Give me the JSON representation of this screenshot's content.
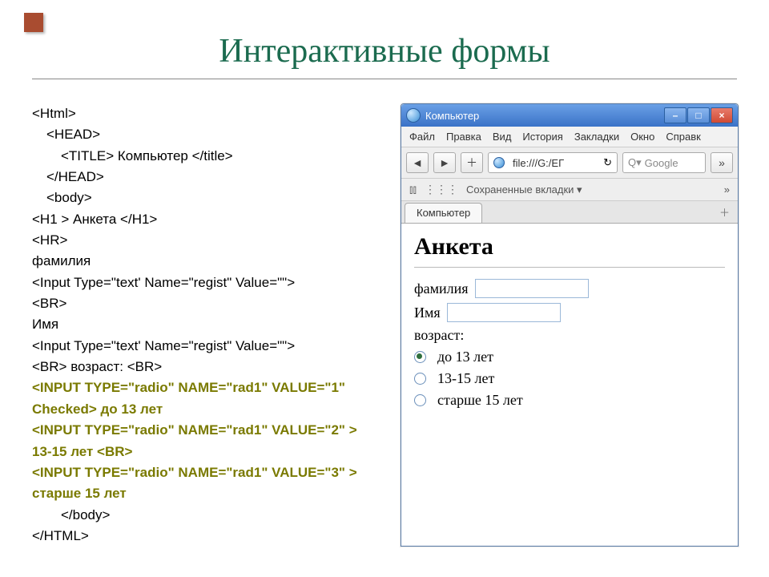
{
  "slide": {
    "title": "Интерактивные формы"
  },
  "code": {
    "l1": "<Html>",
    "l2": "<HEAD>",
    "l3": "<TITLE> Компьютер </title>",
    "l4": "</HEAD>",
    "l5": "<body>",
    "l6": "<H1 > Анкета </H1>",
    "l7": "<HR>",
    "l8": "фамилия",
    "l9": "<Input Type=\"text' Name=\"regist\" Value=\"\">",
    "l10": "<BR>",
    "l11": "Имя",
    "l12": "<Input Type=\"text' Name=\"regist\" Value=\"\">",
    "l13": "<BR> возраст: <BR>",
    "l14": "<INPUT TYPE=\"radio\" NAME=\"rad1\" VALUE=\"1\" Checked> до 13 лет",
    "l15": "<INPUT TYPE=\"radio\" NAME=\"rad1\" VALUE=\"2\" > 13-15 лет <BR>",
    "l16": "<INPUT TYPE=\"radio\" NAME=\"rad1\" VALUE=\"3\" > старше 15 лет",
    "l17": "</body>",
    "l18": "</HTML>"
  },
  "browser": {
    "title": "Компьютер",
    "menu": [
      "Файл",
      "Правка",
      "Вид",
      "История",
      "Закладки",
      "Окно",
      "Справк"
    ],
    "back": "◄",
    "fwd": "►",
    "add": "＋",
    "url": "file:///G:/ЕГ",
    "reload": "↻",
    "searchIcon": "Q▾",
    "searchPlaceholder": "Google",
    "more": "»",
    "bookIcon": "⫾⫾",
    "gridIcon": "⋮⋮⋮",
    "bookmarksLabel": "Сохраненные вкладки ▾",
    "bookmarksMore": "»",
    "tab": "Компьютер",
    "tabAdd": "＋"
  },
  "page": {
    "h1": "Анкета",
    "surnameLabel": "фамилия",
    "nameLabel": "Имя",
    "ageLabel": "возраст:",
    "opt1": "до 13 лет",
    "opt2": "13-15 лет",
    "opt3": "старше 15 лет"
  }
}
